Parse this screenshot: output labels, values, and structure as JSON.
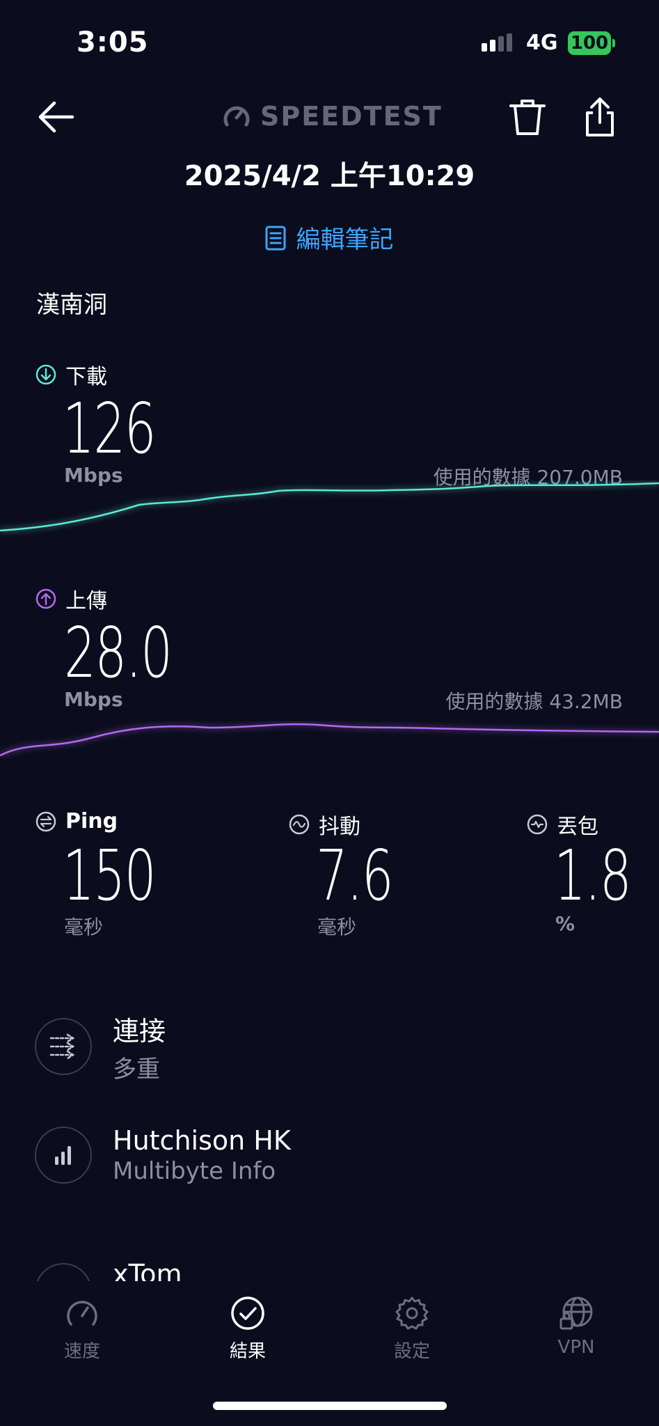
{
  "status_bar": {
    "time": "3:05",
    "network": "4G",
    "battery": "100"
  },
  "header": {
    "logo_text": "SPEEDTEST",
    "datetime": "2025/4/2 上午10:29",
    "edit_note_label": "編輯筆記"
  },
  "location": "漢南洞",
  "download": {
    "label": "下載",
    "value": "126",
    "unit": "Mbps",
    "data_used": "使用的數據 207.0MB"
  },
  "upload": {
    "label": "上傳",
    "value": "28.0",
    "unit": "Mbps",
    "data_used": "使用的數據 43.2MB"
  },
  "ping": {
    "label": "Ping",
    "value": "150",
    "unit": "毫秒"
  },
  "jitter": {
    "label": "抖動",
    "value": "7.6",
    "unit": "毫秒"
  },
  "packet_loss": {
    "label": "丟包",
    "value": "1.8",
    "unit": "%"
  },
  "connection": {
    "title": "連接",
    "subtitle": "多重"
  },
  "isp": {
    "title": "Hutchison HK",
    "subtitle": "Multibyte Info"
  },
  "server": {
    "title": "xTom"
  },
  "tabs": [
    {
      "label": "速度",
      "icon": "speedometer-icon",
      "active": false
    },
    {
      "label": "結果",
      "icon": "check-circle-icon",
      "active": true
    },
    {
      "label": "設定",
      "icon": "gear-icon",
      "active": false
    },
    {
      "label": "VPN",
      "icon": "globe-lock-icon",
      "active": false
    }
  ],
  "colors": {
    "background": "#0b0c1d",
    "download": "#5ee8d8",
    "upload": "#b26bf0",
    "accent": "#3aa6ff",
    "battery": "#34c759"
  }
}
